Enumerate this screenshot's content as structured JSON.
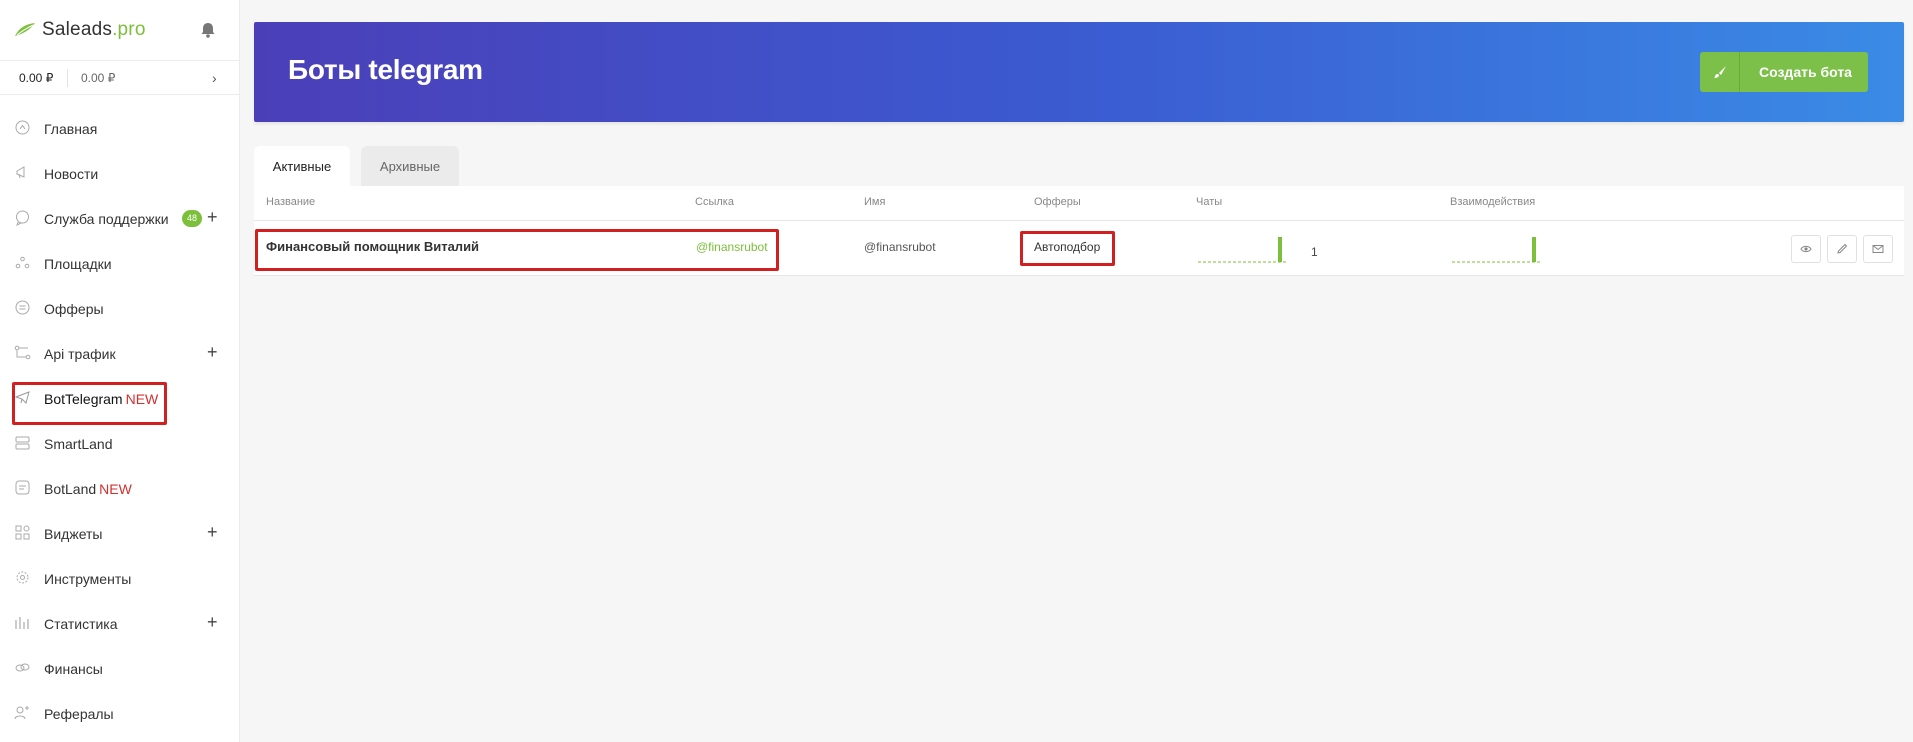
{
  "brand": {
    "name": "Saleads",
    "suffix": ".pro",
    "accent": "#7bbf3a"
  },
  "balance": {
    "primary": "0.00 ₽",
    "secondary": "0.00 ₽"
  },
  "sidebar": {
    "items": [
      {
        "label": "Главная",
        "icon": "home-icon"
      },
      {
        "label": "Новости",
        "icon": "megaphone-icon"
      },
      {
        "label": "Служба поддержки",
        "icon": "chat-icon",
        "badge": "48",
        "plus": "+"
      },
      {
        "label": "Площадки",
        "icon": "sites-icon"
      },
      {
        "label": "Офферы",
        "icon": "offers-icon"
      },
      {
        "label": "Api трафик",
        "icon": "api-icon",
        "plus": "+"
      },
      {
        "label": "BotTelegram",
        "icon": "telegram-icon",
        "tag": "NEW"
      },
      {
        "label": "SmartLand",
        "icon": "smartland-icon"
      },
      {
        "label": "BotLand",
        "icon": "botland-icon",
        "tag": "NEW"
      },
      {
        "label": "Виджеты",
        "icon": "widgets-icon",
        "plus": "+"
      },
      {
        "label": "Инструменты",
        "icon": "gear-icon"
      },
      {
        "label": "Статистика",
        "icon": "stats-icon",
        "plus": "+"
      },
      {
        "label": "Финансы",
        "icon": "coins-icon"
      },
      {
        "label": "Рефералы",
        "icon": "referrals-icon"
      }
    ]
  },
  "header": {
    "title": "Боты telegram",
    "create_label": "Создать бота",
    "gradient_start": "#4b3fb8",
    "gradient_end": "#3a8be6",
    "button_color": "#7cc04a"
  },
  "tabs": [
    {
      "label": "Активные"
    },
    {
      "label": "Архивные"
    }
  ],
  "table": {
    "columns": [
      "Название",
      "Ссылка",
      "Имя",
      "Офферы",
      "Чаты",
      "Взаимодействия"
    ],
    "rows": [
      {
        "name": "Финансовый помощник Виталий",
        "link": "@finansrubot",
        "username": "@finansrubot",
        "offers": "Автоподбор",
        "chats": "1"
      }
    ]
  },
  "highlight_color": "#d21f1f"
}
